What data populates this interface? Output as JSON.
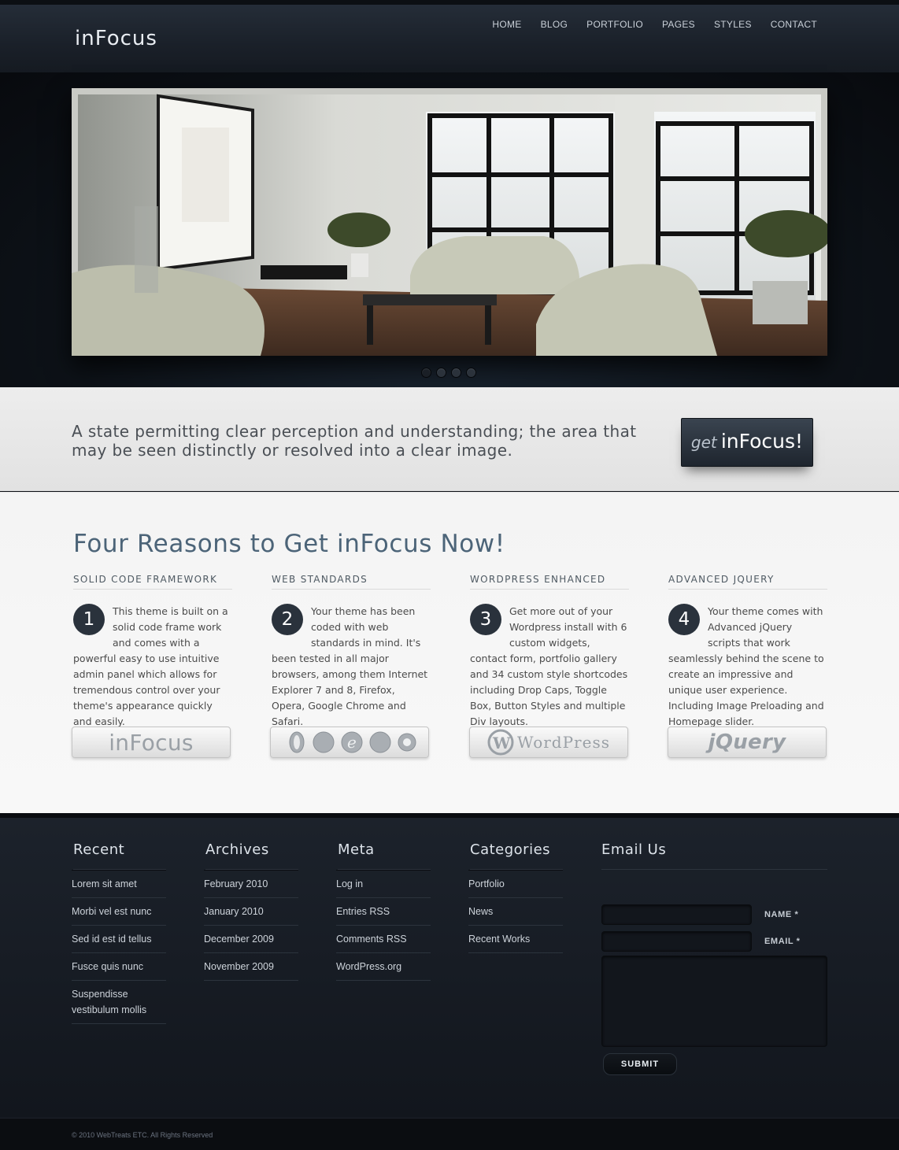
{
  "header": {
    "logo": "inFocus",
    "nav": [
      "HOME",
      "BLOG",
      "PORTFOLIO",
      "PAGES",
      "STYLES",
      "CONTACT"
    ]
  },
  "slider": {
    "dots": 4,
    "active_dot": 1
  },
  "tagline": {
    "text": "A state permitting clear perception and understanding; the area that may be seen distinctly or resolved into a clear image.",
    "cta_get": "get",
    "cta_brand": "inFocus!"
  },
  "main": {
    "title": "Four Reasons to Get inFocus Now!",
    "columns": [
      {
        "heading": "SOLID CODE FRAMEWORK",
        "number": "1",
        "text": "This theme is built on a solid code frame work and comes with a powerful easy to use intuitive admin panel which allows for tremendous control over your theme's appearance quickly and easily.",
        "badge": "inFocus"
      },
      {
        "heading": "WEB STANDARDS",
        "number": "2",
        "text": "Your theme has been coded with web standards in mind. It's been tested in all major browsers, among them Internet Explorer 7 and 8, Firefox, Opera, Google Chrome and Safari.",
        "badge": "browsers"
      },
      {
        "heading": "WORDPRESS ENHANCED",
        "number": "3",
        "text": "Get more out of your Wordpress install with 6 custom widgets, contact form, portfolio gallery and 34 custom style shortcodes including Drop Caps, Toggle Box, Button Styles and multiple Div layouts.",
        "badge": "WordPress"
      },
      {
        "heading": "ADVANCED JQUERY",
        "number": "4",
        "text": "Your theme comes with Advanced jQuery scripts that work seamlessly behind the scene to create an impressive and unique user experience. Including Image Preloading and Homepage slider.",
        "badge": "jQuery"
      }
    ]
  },
  "footer": {
    "recent": {
      "title": "Recent",
      "items": [
        "Lorem sit amet",
        "Morbi vel est nunc",
        "Sed id est id tellus",
        "Fusce quis nunc",
        "Suspendisse vestibulum mollis"
      ]
    },
    "archives": {
      "title": "Archives",
      "items": [
        "February 2010",
        "January 2010",
        "December 2009",
        "November 2009"
      ]
    },
    "meta": {
      "title": "Meta",
      "items": [
        "Log in",
        "Entries RSS",
        "Comments RSS",
        "WordPress.org"
      ]
    },
    "categories": {
      "title": "Categories",
      "items": [
        "Portfolio",
        "News",
        "Recent Works"
      ]
    },
    "email": {
      "title": "Email Us",
      "name_label": "NAME *",
      "email_label": "EMAIL *",
      "submit": "SUBMIT"
    }
  },
  "copyright": "© 2010 WebTreats ETC. All Rights Reserved"
}
